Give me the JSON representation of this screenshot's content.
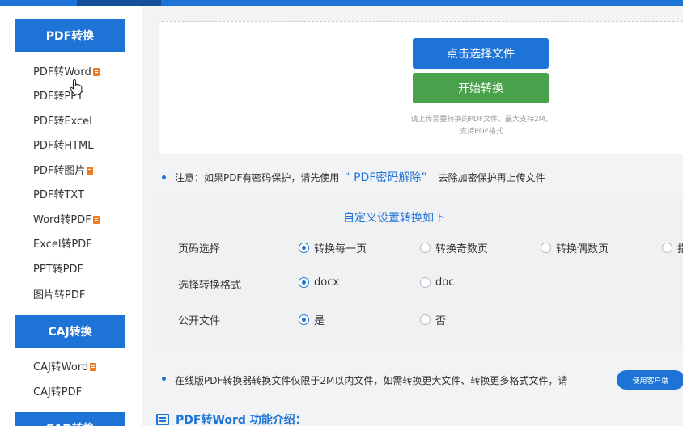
{
  "sidebar": {
    "pdf_header": "PDF转换",
    "pdf_items": [
      {
        "label": "PDF转Word",
        "hot": true
      },
      {
        "label": "PDF转PPT",
        "hot": false
      },
      {
        "label": "PDF转Excel",
        "hot": false
      },
      {
        "label": "PDF转HTML",
        "hot": false
      },
      {
        "label": "PDF转图片",
        "hot": true
      },
      {
        "label": "PDF转TXT",
        "hot": false
      },
      {
        "label": "Word转PDF",
        "hot": true
      },
      {
        "label": "Excel转PDF",
        "hot": false
      },
      {
        "label": "PPT转PDF",
        "hot": false
      },
      {
        "label": "图片转PDF",
        "hot": false
      }
    ],
    "caj_header": "CAJ转换",
    "caj_items": [
      {
        "label": "CAJ转Word",
        "hot": true
      },
      {
        "label": "CAJ转PDF",
        "hot": false
      }
    ],
    "cad_header": "CAD转换"
  },
  "upload": {
    "select_button": "点击选择文件",
    "start_button": "开始转换",
    "tip_line1": "请上传需要转换的PDF文件，最大支持2M，",
    "tip_line2": "支持PDF格式"
  },
  "notice": {
    "prefix": "注意：如果PDF有密码保护，请先使用",
    "link": "“ PDF密码解除”",
    "suffix": "去除加密保护再上传文件"
  },
  "settings": {
    "title": "自定义设置转换如下",
    "rows": [
      {
        "label": "页码选择",
        "options": [
          "转换每一页",
          "转换奇数页",
          "转换偶数页",
          "指"
        ],
        "selected": 0
      },
      {
        "label": "选择转换格式",
        "options": [
          "docx",
          "doc"
        ],
        "selected": 0
      },
      {
        "label": "公开文件",
        "options": [
          "是",
          "否"
        ],
        "selected": 0
      }
    ]
  },
  "bottom_note": {
    "text": "在线版PDF转换器转换文件仅限于2M以内文件，如需转换更大文件、转换更多格式文件，请",
    "client_button": "使用客户端"
  },
  "intro": {
    "title": "PDF转Word 功能介绍："
  },
  "colors": {
    "accent": "#1e74d6",
    "start_green": "#4aa14c",
    "hot_badge": "#f07a1f"
  }
}
